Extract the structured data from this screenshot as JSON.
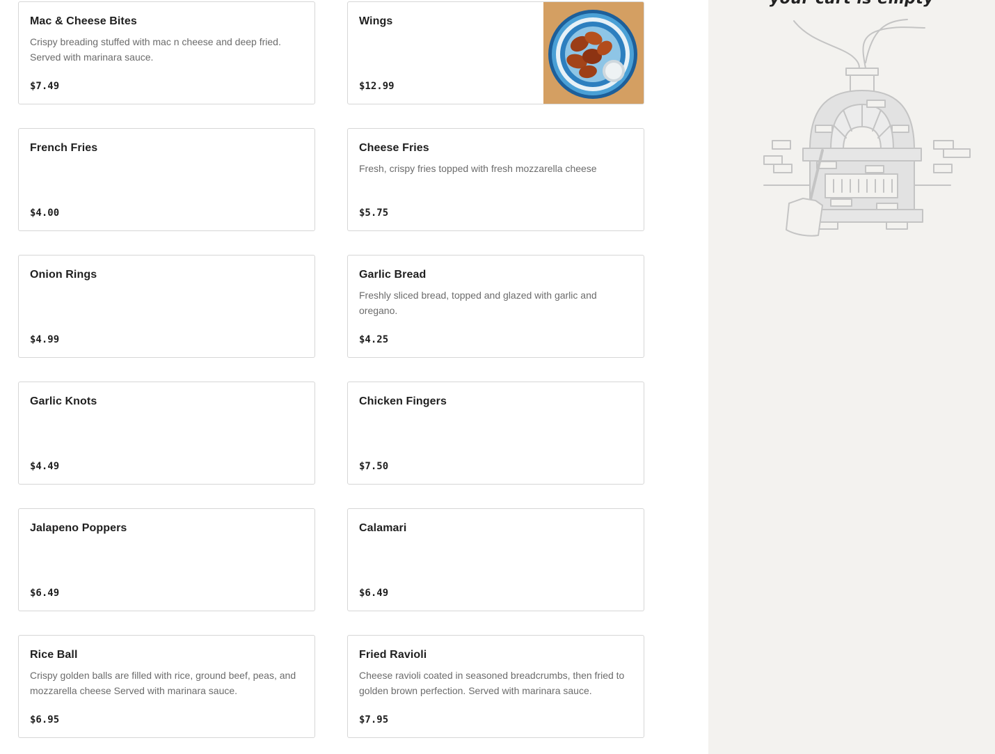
{
  "menu": {
    "items": [
      {
        "name": "Mac & Cheese Bites",
        "description": "Crispy breading stuffed with mac n cheese and deep fried. Served with marinara sauce.",
        "price": "$7.49"
      },
      {
        "name": "Wings",
        "description": "",
        "price": "$12.99",
        "has_image": true
      },
      {
        "name": "French Fries",
        "description": "",
        "price": "$4.00"
      },
      {
        "name": "Cheese Fries",
        "description": "Fresh, crispy fries topped with fresh mozzarella cheese",
        "price": "$5.75"
      },
      {
        "name": "Onion Rings",
        "description": "",
        "price": "$4.99"
      },
      {
        "name": "Garlic Bread",
        "description": "Freshly sliced bread, topped and glazed with garlic and oregano.",
        "price": "$4.25"
      },
      {
        "name": "Garlic Knots",
        "description": "",
        "price": "$4.49"
      },
      {
        "name": "Chicken Fingers",
        "description": "",
        "price": "$7.50"
      },
      {
        "name": "Jalapeno Poppers",
        "description": "",
        "price": "$6.49"
      },
      {
        "name": "Calamari",
        "description": "",
        "price": "$6.49"
      },
      {
        "name": "Rice Ball",
        "description": "Crispy golden balls are filled with rice, ground beef, peas, and mozzarella cheese Served with marinara sauce.",
        "price": "$6.95"
      },
      {
        "name": "Fried Ravioli",
        "description": "Cheese ravioli coated in seasoned breadcrumbs, then fried to golden brown perfection. Served with marinara sauce.",
        "price": "$7.95"
      }
    ]
  },
  "cart": {
    "empty_message": "your cart is empty",
    "illustration": "pizza-oven-icon"
  },
  "colors": {
    "sidebar_bg": "#f3f2ef",
    "card_border": "#d6d6d6",
    "description_text": "#6b6b6b"
  }
}
